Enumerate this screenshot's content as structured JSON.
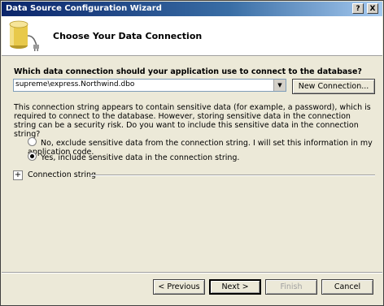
{
  "window": {
    "title": "Data Source Configuration Wizard",
    "help_button": "?",
    "close_button": "X"
  },
  "header": {
    "heading": "Choose Your Data Connection",
    "icon": "database-icon"
  },
  "main": {
    "question": "Which data connection should your application use to connect to the database?",
    "connection_combo": {
      "value": "supreme\\express.Northwind.dbo"
    },
    "new_connection_button": "New Connection...",
    "sensitive_paragraph": "This connection string appears to contain sensitive data (for example, a password), which is required to connect to the database. However, storing sensitive data in the connection string can be a security risk. Do you want to include this sensitive data in the connection string?",
    "options": [
      {
        "label": "No, exclude sensitive data from the connection string. I will set this information in my application code.",
        "selected": false
      },
      {
        "label": "Yes, include sensitive data in the connection string.",
        "selected": true
      }
    ],
    "expander_glyph": "+",
    "connection_string_label": "Connection string"
  },
  "footer": {
    "previous_button": "< Previous",
    "next_button": "Next >",
    "finish_button": "Finish",
    "cancel_button": "Cancel"
  }
}
